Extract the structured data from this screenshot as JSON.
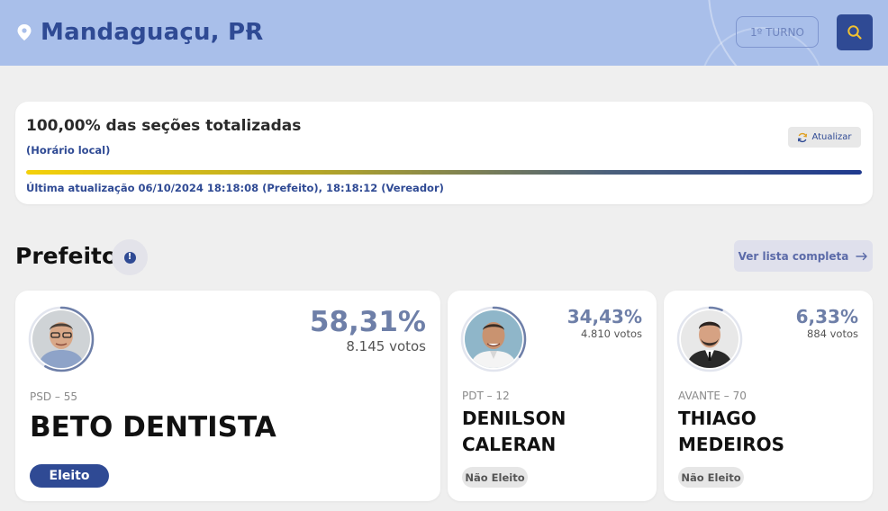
{
  "header": {
    "location": "Mandaguaçu, PR",
    "round_button": "1º TURNO",
    "bg_color": "#a9bfea",
    "accent": "#2f4a94",
    "icons": [
      "location-pin-icon",
      "chevron-down-icon",
      "search-icon"
    ]
  },
  "status": {
    "title": "100,00% das seções totalizadas",
    "subtitle": "(Horário local)",
    "refresh_label": "Atualizar",
    "progress_percent": 100,
    "last_update": "Última atualização 06/10/2024 18:18:08 (Prefeito), 18:18:12 (Vereador)"
  },
  "section": {
    "title": "Prefeito",
    "full_list_label": "Ver lista completa"
  },
  "candidates": [
    {
      "pct": "58,31%",
      "votes": "8.145 votos",
      "party": "PSD – 55",
      "name": "BETO DENTISTA",
      "status": "Eleito",
      "share": 0.5831
    },
    {
      "pct": "34,43%",
      "votes": "4.810 votos",
      "party": "PDT – 12",
      "name": "DENILSON CALERAN",
      "status": "Não Eleito",
      "share": 0.3443
    },
    {
      "pct": "6,33%",
      "votes": "884 votos",
      "party": "AVANTE – 70",
      "name": "THIAGO MEDEIROS",
      "status": "Não Eleito",
      "share": 0.0633
    }
  ]
}
